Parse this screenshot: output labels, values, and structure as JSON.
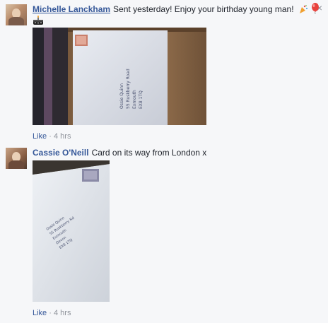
{
  "comments": [
    {
      "author": "Michelle Lanckham",
      "text": "Sent yesterday! Enjoy your birthday young man!",
      "emoji_icons": [
        "party-popper-icon",
        "balloon-icon"
      ],
      "sticker_icon": "birthday-cake-icon",
      "like_label": "Like",
      "separator": "·",
      "time": "4 hrs",
      "photo_address": [
        "Ossie Quinn",
        "55 Ruskberry Road",
        "Exmouth",
        "EX8 1TQ"
      ]
    },
    {
      "author": "Cassie O'Neill",
      "text": "Card on its way from London x",
      "like_label": "Like",
      "separator": "·",
      "time": "4 hrs",
      "photo_address": [
        "Ossie Quinn",
        "55 Ruskberry Rd",
        "Exmouth",
        "Devon",
        "EX8 1TQ"
      ]
    }
  ],
  "close_glyph": "×",
  "colors": {
    "author_link": "#365899",
    "meta": "#90949c",
    "background": "#f6f7f9"
  }
}
